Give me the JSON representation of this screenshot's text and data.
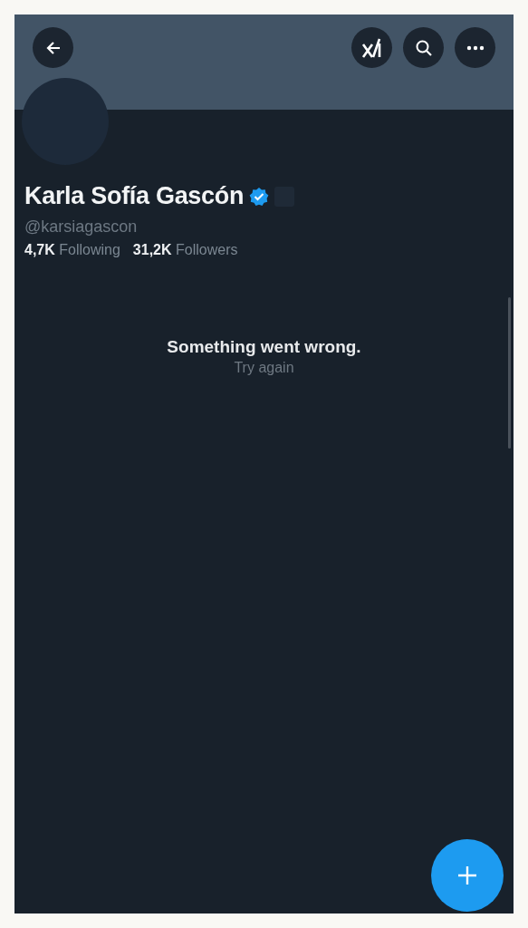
{
  "profile": {
    "name": "Karla Sofía Gascón",
    "verified": true,
    "handle": "@karsiagascon",
    "stats": [
      {
        "count": "4,7K",
        "label": "Following"
      },
      {
        "count": "31,2K",
        "label": "Followers"
      }
    ]
  },
  "error": {
    "message": "Something went wrong.",
    "action": "Try again"
  }
}
